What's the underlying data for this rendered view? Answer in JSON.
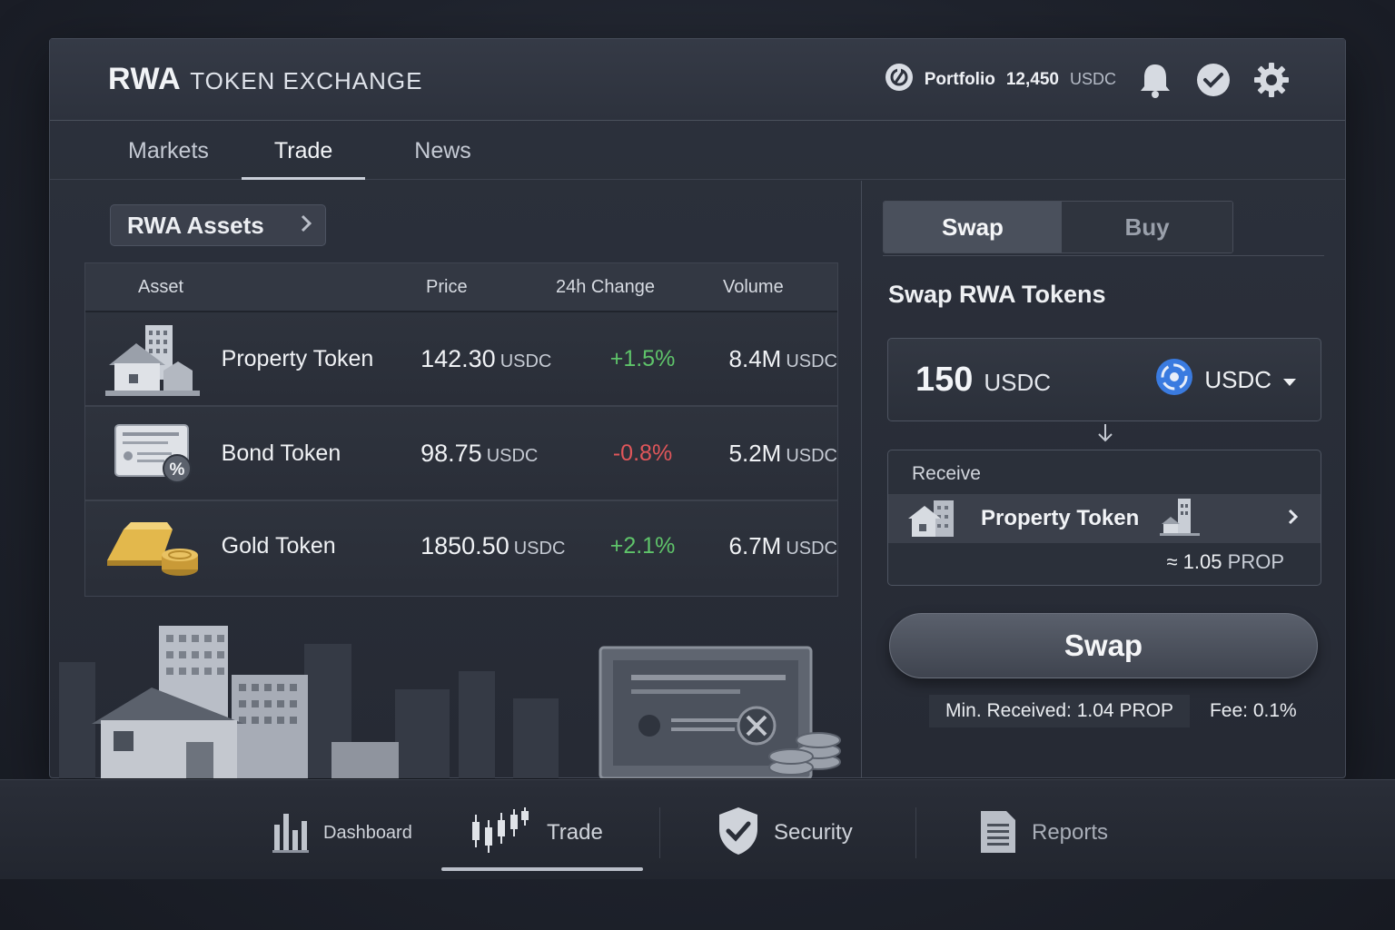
{
  "header": {
    "brand_bold": "RWA",
    "brand_light": "TOKEN EXCHANGE",
    "portfolio_label": "Portfolio",
    "portfolio_amount": "12,450",
    "portfolio_unit": "USDC"
  },
  "tabs": [
    {
      "label": "Markets"
    },
    {
      "label": "Trade",
      "active": true
    },
    {
      "label": "News"
    }
  ],
  "assets_chip": "RWA Assets",
  "table": {
    "columns": [
      "Asset",
      "Price",
      "24h Change",
      "Volume"
    ],
    "rows": [
      {
        "name": "Property Token",
        "price": "142.30",
        "price_unit": "USDC",
        "change": "+1.5%",
        "volume": "8.4M",
        "volume_unit": "USDC",
        "icon": "property-icon"
      },
      {
        "name": "Bond Token",
        "price": "98.75",
        "price_unit": "USDC",
        "change": "-0.8%",
        "volume": "5.2M",
        "volume_unit": "USDC",
        "icon": "bond-icon"
      },
      {
        "name": "Gold Token",
        "price": "1850.50",
        "price_unit": "USDC",
        "change": "+2.1%",
        "volume": "6.7M",
        "volume_unit": "USDC",
        "icon": "gold-icon"
      }
    ]
  },
  "swap_panel": {
    "seg_swap": "Swap",
    "seg_buy": "Buy",
    "title": "Swap RWA Tokens",
    "amount": "150",
    "amount_unit": "USDC",
    "pay_token": "USDC",
    "receive_label": "Receive",
    "receive_token": "Property Token",
    "estimate_prefix": "≈ 1.05",
    "estimate_unit": "PROP",
    "swap_button": "Swap",
    "min_received_label": "Min. Received:",
    "min_received_value": "1.04",
    "min_received_unit": "PROP",
    "fee_label": "Fee:",
    "fee_value": "0.1%"
  },
  "bottom_nav": [
    {
      "label": "Dashboard",
      "icon": "bar-chart-icon"
    },
    {
      "label": "Trade",
      "icon": "candlestick-icon",
      "active": true
    },
    {
      "label": "Security",
      "icon": "shield-check-icon"
    },
    {
      "label": "Reports",
      "icon": "document-icon"
    }
  ],
  "colors": {
    "positive": "#5fc46a",
    "negative": "#e0565a",
    "usdc_blue": "#3a7be0"
  }
}
